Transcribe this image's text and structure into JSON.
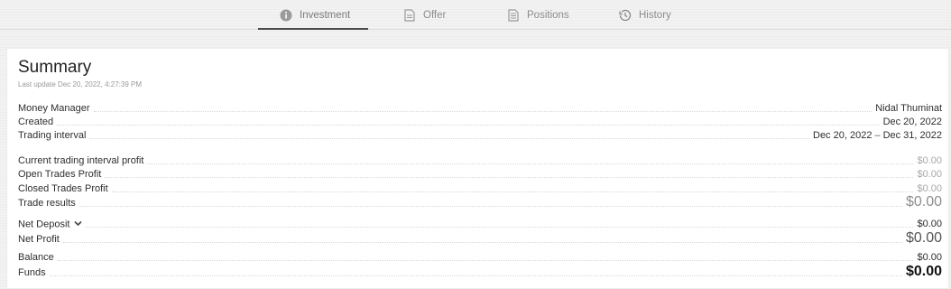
{
  "tabs": [
    {
      "label": "Investment",
      "icon": "info-icon",
      "active": true
    },
    {
      "label": "Offer",
      "icon": "document-icon",
      "active": false
    },
    {
      "label": "Positions",
      "icon": "list-document-icon",
      "active": false
    },
    {
      "label": "History",
      "icon": "history-icon",
      "active": false
    }
  ],
  "summary": {
    "title": "Summary",
    "last_update": "Last update Dec 20, 2022, 4:27:39 PM",
    "money_manager": {
      "label": "Money Manager",
      "value": "Nidal Thuminat"
    },
    "created": {
      "label": "Created",
      "value": "Dec 20, 2022"
    },
    "trading_interval": {
      "label": "Trading interval",
      "start": "Dec 20, 2022",
      "end": "Dec 31, 2022"
    },
    "current_profit": {
      "label": "Current trading interval profit",
      "value": "$0.00"
    },
    "open_trades": {
      "label": "Open Trades Profit",
      "value": "$0.00"
    },
    "closed_trades": {
      "label": "Closed Trades Profit",
      "value": "$0.00"
    },
    "trade_results": {
      "label": "Trade results",
      "value": "$0.00"
    },
    "net_deposit": {
      "label": "Net Deposit",
      "value": "$0.00"
    },
    "net_profit": {
      "label": "Net Profit",
      "value": "$0.00"
    },
    "balance": {
      "label": "Balance",
      "value": "$0.00"
    },
    "funds": {
      "label": "Funds",
      "value": "$0.00"
    }
  }
}
